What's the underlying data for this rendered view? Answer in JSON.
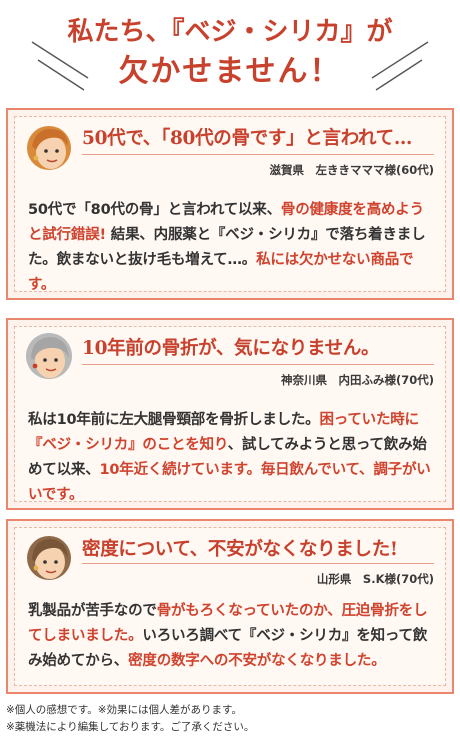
{
  "header": {
    "title_line1": "私たち、『ベジ・シリカ』が",
    "title_line2": "欠かせません！"
  },
  "testimonials": [
    {
      "headline": "50代で、「80代の骨です」と言われて…",
      "person": "滋賀県　左ききマママ様(60代)",
      "body": [
        {
          "t": "50代で「80代の骨」と言われて以来、",
          "h": false
        },
        {
          "t": "骨の健康度を高めようと試行錯誤!",
          "h": true
        },
        {
          "t": " 結果、内服薬と『ベジ・シリカ』で落ち着きました。飲まないと抜け毛も増えて…。",
          "h": false
        },
        {
          "t": "私には欠かせない商品です。",
          "h": true
        }
      ]
    },
    {
      "headline": "10年前の骨折が、気になりません。",
      "person": "神奈川県　内田ふみ様(70代)",
      "body": [
        {
          "t": "私は10年前に左大腿骨頸部を骨折しました。",
          "h": false
        },
        {
          "t": "困っていた時に『ベジ・シリカ』のことを知り",
          "h": true
        },
        {
          "t": "、試してみようと思って飲み始めて以来、",
          "h": false
        },
        {
          "t": "10年近く続けています。毎日飲んでいて、調子がいいです。",
          "h": true
        }
      ]
    },
    {
      "headline": "密度について、不安がなくなりました!",
      "person": "山形県　S.K様(70代)",
      "body": [
        {
          "t": "乳製品が苦手なので",
          "h": false
        },
        {
          "t": "骨がもろくなっていたのか、圧迫骨折をしてしまいました。",
          "h": true
        },
        {
          "t": "いろいろ調べて『ベジ・シリカ』を知って飲み始めてから、",
          "h": false
        },
        {
          "t": "密度の数字への不安がなくなりました。",
          "h": true
        }
      ]
    }
  ],
  "footnotes": {
    "line1": "※個人の感想です。※効果には個人差があります。",
    "line2": "※薬機法により編集しております。ご了承ください。"
  },
  "colors": {
    "accent": "#c8412d",
    "card_border": "#e9866e",
    "card_bg": "#fdf3ec"
  }
}
